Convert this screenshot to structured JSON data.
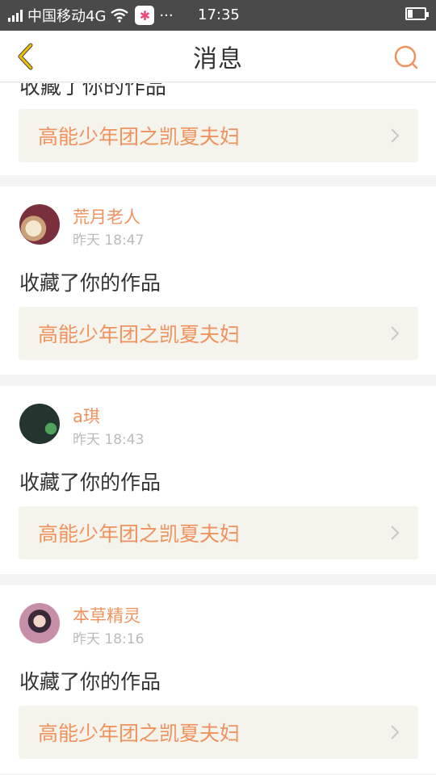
{
  "status_bar": {
    "carrier": "中国移动4G",
    "more": "···",
    "time": "17:35"
  },
  "nav": {
    "title": "消息"
  },
  "partial_item": {
    "action": "收藏了你的作品",
    "work_title": "高能少年团之凯夏夫妇"
  },
  "messages": [
    {
      "username": "荒月老人",
      "time": "昨天 18:47",
      "action": "收藏了你的作品",
      "work_title": "高能少年团之凯夏夫妇"
    },
    {
      "username": "a琪",
      "time": "昨天 18:43",
      "action": "收藏了你的作品",
      "work_title": "高能少年团之凯夏夫妇"
    },
    {
      "username": "本草精灵",
      "time": "昨天 18:16",
      "action": "收藏了你的作品",
      "work_title": "高能少年团之凯夏夫妇"
    }
  ],
  "colors": {
    "accent": "#f0925e",
    "back_icon": "#f0c000",
    "search_icon": "#f0925e",
    "link_bg": "#f4f3ec"
  }
}
